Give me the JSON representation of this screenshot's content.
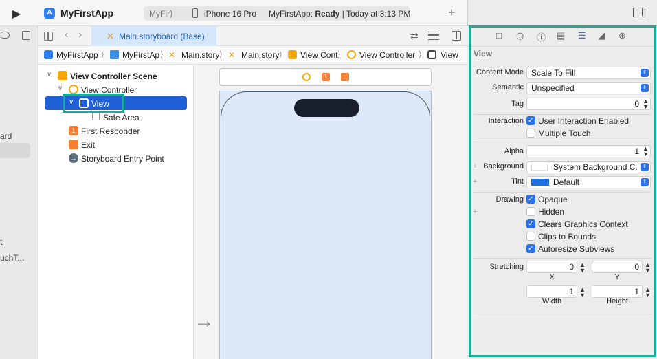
{
  "titlebar": {
    "app_title": "MyFirstApp",
    "scheme_target": "MyFir⟩",
    "device": "iPhone 16 Pro",
    "status_app": "MyFirstApp:",
    "status_state": "Ready",
    "status_time": "| Today at 3:13 PM"
  },
  "left_sidebar": {
    "items": [
      "ard",
      "t",
      "uchT..."
    ]
  },
  "editor_tab": {
    "label": "Main.storyboard (Base)"
  },
  "breadcrumb": [
    "MyFirstApp",
    "MyFirstAp",
    "Main.story",
    "Main.story",
    "View Cont",
    "View Controller",
    "View"
  ],
  "outline": {
    "scene": "View Controller Scene",
    "view_controller": "View Controller",
    "view": "View",
    "safe_area": "Safe Area",
    "first_responder": "First Responder",
    "exit": "Exit",
    "entry_point": "Storyboard Entry Point"
  },
  "inspector": {
    "section_title": "View",
    "content_mode_label": "Content Mode",
    "content_mode_value": "Scale To Fill",
    "semantic_label": "Semantic",
    "semantic_value": "Unspecified",
    "tag_label": "Tag",
    "tag_value": "0",
    "interaction_label": "Interaction",
    "user_interaction": "User Interaction Enabled",
    "multiple_touch": "Multiple Touch",
    "alpha_label": "Alpha",
    "alpha_value": "1",
    "background_label": "Background",
    "background_value": "System Background C...",
    "tint_label": "Tint",
    "tint_value": "Default",
    "drawing_label": "Drawing",
    "opaque": "Opaque",
    "hidden": "Hidden",
    "clears_graphics": "Clears Graphics Context",
    "clips_bounds": "Clips to Bounds",
    "autoresize": "Autoresize Subviews",
    "stretching_label": "Stretching",
    "stretch_x": "0",
    "stretch_y": "0",
    "x_label": "X",
    "y_label": "Y",
    "stretch_w": "1",
    "stretch_h": "1",
    "width_label": "Width",
    "height_label": "Height",
    "checks": {
      "user_interaction": true,
      "multiple_touch": false,
      "opaque": true,
      "hidden": false,
      "clears_graphics": true,
      "clips_bounds": false,
      "autoresize": true
    }
  },
  "colors": {
    "accent": "#2a72e5",
    "highlight": "#16ae98",
    "selection": "#1f5fd8"
  }
}
